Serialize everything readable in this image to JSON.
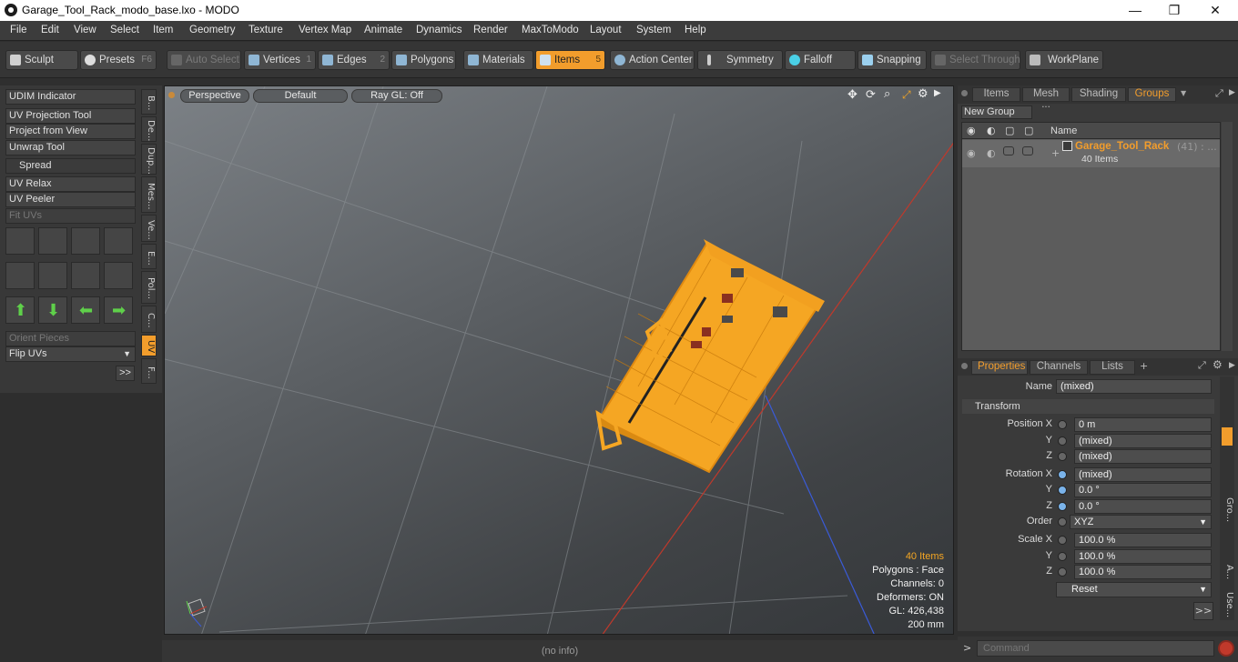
{
  "window": {
    "title": "Garage_Tool_Rack_modo_base.lxo - MODO",
    "minimize": "—",
    "maximize": "❐",
    "close": "✕"
  },
  "menu": [
    "File",
    "Edit",
    "View",
    "Select",
    "Item",
    "Geometry",
    "Texture",
    "Vertex Map",
    "Animate",
    "Dynamics",
    "Render",
    "MaxToModo",
    "Layout",
    "System",
    "Help"
  ],
  "toolbar": {
    "sculpt": "Sculpt",
    "presets": "Presets",
    "presets_hotkey": "F6",
    "auto_select": "Auto Select",
    "vertices": "Vertices",
    "vertices_hotkey": "1",
    "edges": "Edges",
    "edges_hotkey": "2",
    "polygons": "Polygons",
    "materials": "Materials",
    "items": "Items",
    "items_hotkey": "5",
    "action_center": "Action Center",
    "symmetry": "Symmetry",
    "falloff": "Falloff",
    "snapping": "Snapping",
    "select_through": "Select Through",
    "workplane": "WorkPlane"
  },
  "left_panel": {
    "udim_indicator": "UDIM Indicator",
    "uv_projection_tool": "UV Projection Tool",
    "project_from_view": "Project from View",
    "unwrap_tool": "Unwrap Tool",
    "spread": "Spread",
    "uv_relax": "UV Relax",
    "uv_peeler": "UV Peeler",
    "fit_uvs": "Fit UVs",
    "orient_pieces": "Orient Pieces",
    "flip_uvs": "Flip UVs",
    "more": ">>",
    "vtabs": [
      "B...",
      "De...",
      "Dup...",
      "Mes...",
      "Ve...",
      "E...",
      "Pol...",
      "C...",
      "UV",
      "F..."
    ]
  },
  "viewport": {
    "perspective": "Perspective",
    "default": "Default",
    "ray_gl": "Ray GL: Off",
    "stats": {
      "items": "40 Items",
      "polygons": "Polygons : Face",
      "channels": "Channels: 0",
      "deformers": "Deformers: ON",
      "gl": "GL: 426,438",
      "scale": "200 mm"
    }
  },
  "groups_panel": {
    "tabs": [
      "Items",
      "Mesh ...",
      "Shading",
      "Groups"
    ],
    "active_tab": "Groups",
    "new_group": "New Group",
    "col_name": "Name",
    "group_name": "Garage_Tool_Rack",
    "group_count": "(41)",
    "group_extra": ": ...",
    "group_items": "40 Items"
  },
  "properties_panel": {
    "tabs": [
      "Properties",
      "Channels",
      "Lists",
      "+"
    ],
    "name_label": "Name",
    "name_value": "(mixed)",
    "transform": "Transform",
    "position_x_label": "Position X",
    "position_x": "0 m",
    "position_y_label": "Y",
    "position_y": "(mixed)",
    "position_z_label": "Z",
    "position_z": "(mixed)",
    "rotation_x_label": "Rotation X",
    "rotation_x": "(mixed)",
    "rotation_y_label": "Y",
    "rotation_y": "0.0 °",
    "rotation_z_label": "Z",
    "rotation_z": "0.0 °",
    "order_label": "Order",
    "order": "XYZ",
    "scale_x_label": "Scale X",
    "scale_x": "100.0 %",
    "scale_y_label": "Y",
    "scale_y": "100.0 %",
    "scale_z_label": "Z",
    "scale_z": "100.0 %",
    "reset": "Reset",
    "more": ">>",
    "side_tabs": [
      "Gro...",
      "A...",
      "Use..."
    ]
  },
  "status": {
    "info": "(no info)"
  },
  "command": {
    "prompt": ">",
    "placeholder": "Command"
  },
  "colors": {
    "accent": "#f29d2c",
    "model": "#f5a623",
    "axis_red": "#c0392b",
    "axis_blue": "#3a5bd9"
  }
}
